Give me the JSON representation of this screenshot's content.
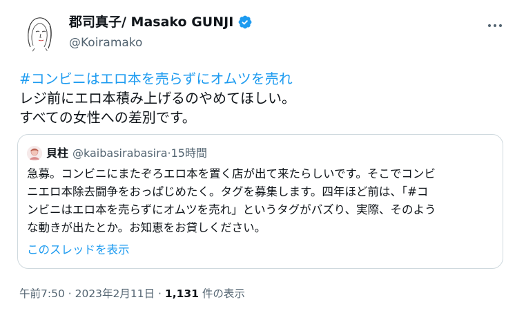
{
  "author": {
    "name": "郡司真子/ Masako GUNJI",
    "handle": "@Koiramako",
    "verified_color": "#1d9bf0",
    "avatar_icon": "line-drawing-portrait"
  },
  "tweet": {
    "hashtag": "#コンビニはエロ本を売らずにオムツを売れ",
    "lines": [
      "レジ前にエロ本積み上げるのやめてほしい。",
      "すべての女性への差別です。"
    ]
  },
  "quote": {
    "name": "貝柱",
    "handle": "@kaibasirabasira",
    "separator": " · ",
    "time": "15時間",
    "lines": [
      "急募。コンビニにまたぞろエロ本を置く店が出て来たらしいです。そこでコンビ",
      "ニエロ本除去闘争をおっぱじめたく。タグを募集します。四年ほど前は、「#コ",
      "ンビニはエロ本を売らずにオムツを売れ」というタグがバズり、実際、そのよう",
      "な動きが出たとか。お知恵をお貸しください。"
    ],
    "thread_link": "このスレッドを表示"
  },
  "footer": {
    "time": "午前7:50",
    "sep1": " · ",
    "date": "2023年2月11日",
    "sep2": " · ",
    "views": "1,131",
    "views_label": " 件の表示"
  },
  "colors": {
    "accent": "#1d9bf0",
    "text": "#0f1419",
    "muted": "#536471",
    "border": "#cfd9de"
  }
}
